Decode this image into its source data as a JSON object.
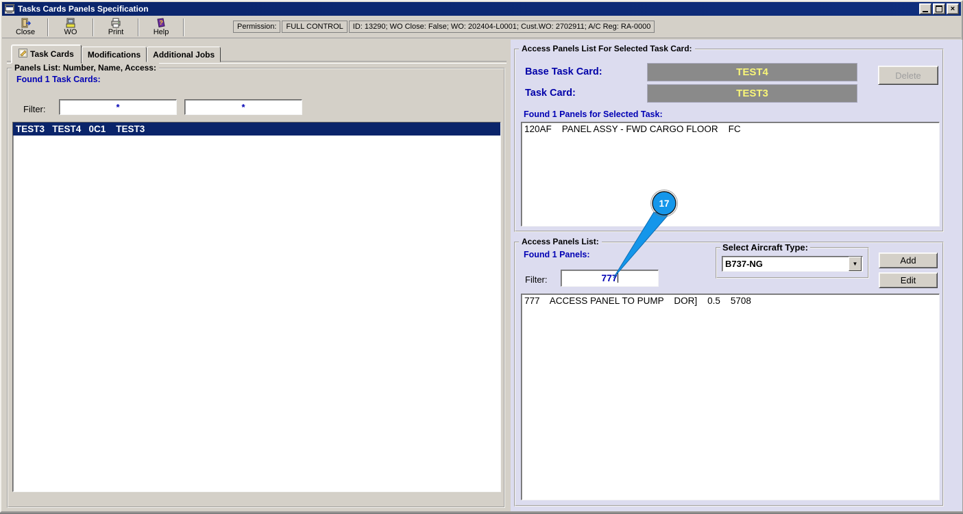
{
  "window": {
    "title": "Tasks Cards Panels Specification",
    "controls": {
      "minimize": "minimize",
      "restore": "restore",
      "close": "close"
    }
  },
  "toolbar": {
    "buttons": [
      {
        "label": "Close",
        "icon": "exit-door-icon"
      },
      {
        "label": "WO",
        "icon": "work-order-icon"
      },
      {
        "label": "Print",
        "icon": "printer-icon"
      },
      {
        "label": "Help",
        "icon": "help-book-icon"
      }
    ],
    "permission_label": "Permission:",
    "permission_value": "FULL CONTROL",
    "context_info": "ID: 13290; WO Close: False; WO: 202404-L0001; Cust.WO: 2702911; A/C Reg: RA-0000"
  },
  "tabs": [
    {
      "label": "Task Cards",
      "icon": "task-card-icon"
    },
    {
      "label": "Modifications"
    },
    {
      "label": "Additional Jobs"
    }
  ],
  "left_panel": {
    "group_title": "Panels List: Number, Name, Access:",
    "found_text": "Found 1 Task Cards:",
    "filter_label": "Filter:",
    "filter1_value": "*",
    "filter2_value": "*",
    "rows": [
      "TEST3   TEST4   0C1    TEST3"
    ]
  },
  "right_top_panel": {
    "group_title": "Access Panels List For Selected Task Card:",
    "base_task_card_label": "Base Task Card:",
    "base_task_card_value": "TEST4",
    "task_card_label": "Task Card:",
    "task_card_value": "TEST3",
    "delete_button": "Delete",
    "found_text": "Found 1 Panels for Selected Task:",
    "rows": [
      "120AF    PANEL ASSY - FWD CARGO FLOOR    FC"
    ]
  },
  "right_bottom_panel": {
    "group_title": "Access Panels List:",
    "found_text": "Found 1 Panels:",
    "filter_label": "Filter:",
    "filter_value": "777",
    "aircraft_group_title": "Select Aircraft Type:",
    "aircraft_value": "B737-NG",
    "add_button": "Add",
    "edit_button": "Edit",
    "rows": [
      "777    ACCESS PANEL TO PUMP    DOR]    0.5    5708"
    ]
  },
  "callout": {
    "number": "17"
  },
  "colors": {
    "titlebar": "#0a246a",
    "window_bg": "#d4d0c8",
    "right_panel_bg": "#dcdcef",
    "selection_bg": "#0a246a",
    "value_box_bg": "#8a8a8a",
    "value_text": "#f8f578",
    "blue_text": "#0000b4",
    "callout_blue": "#1496ea"
  }
}
